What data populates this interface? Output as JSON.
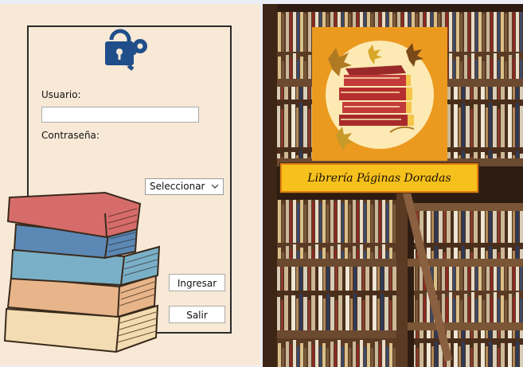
{
  "login": {
    "user_label": "Usuario:",
    "user_value": "",
    "password_label": "Contraseña:",
    "select_value": "Seleccionar",
    "login_button": "Ingresar",
    "exit_button": "Salir"
  },
  "brand": {
    "title": "Librería Páginas Doradas"
  },
  "colors": {
    "left_panel_bg": "#f8e9d6",
    "logo_bg": "#eb9a1f",
    "title_badge_bg": "#f6c11c",
    "icon_blue": "#1f4e8a"
  },
  "icons": [
    "lock-key-icon",
    "books-stack-illustration",
    "bookshelf-photo",
    "library-logo"
  ]
}
